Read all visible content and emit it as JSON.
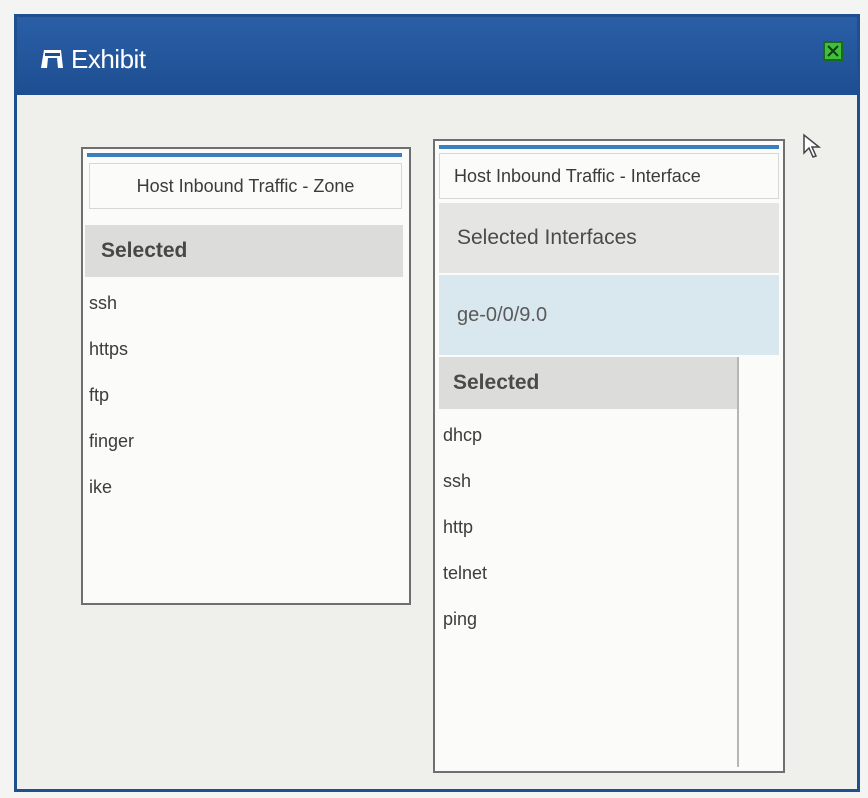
{
  "window": {
    "title": "Exhibit",
    "title_icon": "exhibit-icon",
    "close_icon": "close-icon"
  },
  "zone_panel": {
    "header": "Host Inbound Traffic - Zone",
    "selected_label": "Selected",
    "items": [
      "ssh",
      "https",
      "ftp",
      "finger",
      "ike"
    ]
  },
  "interface_panel": {
    "header": "Host Inbound Traffic - Interface",
    "selected_interfaces_label": "Selected Interfaces",
    "selected_interface": "ge-0/0/9.0",
    "selected_label": "Selected",
    "items": [
      "dhcp",
      "ssh",
      "http",
      "telnet",
      "ping"
    ]
  },
  "colors": {
    "titlebar": "#1e4e92",
    "accent": "#3a7fc2",
    "highlight": "#d8e8ee",
    "close": "#3fbe3f"
  }
}
